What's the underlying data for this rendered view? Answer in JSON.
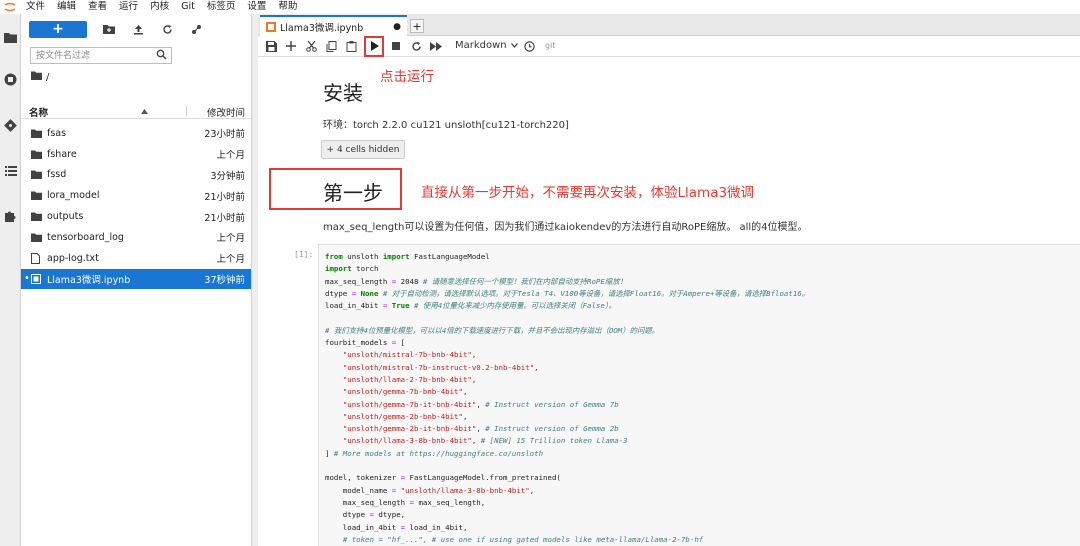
{
  "menu": [
    "文件",
    "编辑",
    "查看",
    "运行",
    "内核",
    "Git",
    "标签页",
    "设置",
    "帮助"
  ],
  "file_browser": {
    "new_label": "+",
    "filter_placeholder": "按文件名过滤",
    "breadcrumb": "/",
    "col_name": "名称",
    "col_modified": "修改时间",
    "items": [
      {
        "name": "fsas",
        "modified": "23小时前",
        "kind": "folder"
      },
      {
        "name": "fshare",
        "modified": "上个月",
        "kind": "folder"
      },
      {
        "name": "fssd",
        "modified": "3分钟前",
        "kind": "folder"
      },
      {
        "name": "lora_model",
        "modified": "21小时前",
        "kind": "folder"
      },
      {
        "name": "outputs",
        "modified": "21小时前",
        "kind": "folder"
      },
      {
        "name": "tensorboard_log",
        "modified": "上个月",
        "kind": "folder"
      },
      {
        "name": "app-log.txt",
        "modified": "上个月",
        "kind": "file"
      },
      {
        "name": "Llama3微调.ipynb",
        "modified": "37秒钟前",
        "kind": "notebook"
      }
    ]
  },
  "tab": {
    "title": "Llama3微调.ipynb",
    "add": "+"
  },
  "toolbar": {
    "cell_type": "Markdown",
    "git": "git"
  },
  "annotations": {
    "run": "点击运行",
    "step": "直接从第一步开始，不需要再次安装，体验Llama3微调"
  },
  "notebook": {
    "h_install": "安装",
    "env_line": "环境：torch 2.2.0 cu121 unsloth[cu121-torch220]",
    "hidden_cells": "+ 4 cells hidden",
    "h_step": "第一步",
    "maxseq_line": "max_seq_length可以设置为任何值，因为我们通过kaiokendev的方法进行自动RoPE缩放。 all的4位模型。",
    "prompt": "[1]:"
  },
  "code_lines": [
    [
      [
        "kw",
        "from"
      ],
      [
        "t",
        " unsloth "
      ],
      [
        "kw",
        "import"
      ],
      [
        "t",
        " FastLanguageModel"
      ]
    ],
    [
      [
        "kw",
        "import"
      ],
      [
        "t",
        " torch"
      ]
    ],
    [
      [
        "t",
        "max_seq_length "
      ],
      [
        "op",
        "="
      ],
      [
        "t",
        " 2048 "
      ],
      [
        "cm",
        "# 请随意选择任何一个模型！我们在内部自动支持RoPE缩放！"
      ]
    ],
    [
      [
        "t",
        "dtype "
      ],
      [
        "op",
        "="
      ],
      [
        "t",
        " "
      ],
      [
        "kw",
        "None"
      ],
      [
        "t",
        " "
      ],
      [
        "cm",
        "# 对于自动检测，请选择默认选项。对于Tesla T4、V100等设备，请选择Float16。对于Ampere+等设备，请选择Bfloat16。"
      ]
    ],
    [
      [
        "t",
        "load_in_4bit "
      ],
      [
        "op",
        "="
      ],
      [
        "t",
        " "
      ],
      [
        "kw",
        "True"
      ],
      [
        "t",
        " "
      ],
      [
        "cm",
        "# 使用4位量化来减少内存使用量。可以选择关闭（False）。"
      ]
    ],
    [
      [
        "t",
        ""
      ]
    ],
    [
      [
        "cm",
        "# 我们支持4位预量化模型，可以以4倍的下载速度进行下载，并且不会出现内存溢出（OOM）的问题。"
      ]
    ],
    [
      [
        "t",
        "fourbit_models "
      ],
      [
        "op",
        "="
      ],
      [
        "t",
        " ["
      ]
    ],
    [
      [
        "t",
        "    "
      ],
      [
        "st",
        "\"unsloth/mistral-7b-bnb-4bit\""
      ],
      [
        "t",
        ","
      ]
    ],
    [
      [
        "t",
        "    "
      ],
      [
        "st",
        "\"unsloth/mistral-7b-instruct-v0.2-bnb-4bit\""
      ],
      [
        "t",
        ","
      ]
    ],
    [
      [
        "t",
        "    "
      ],
      [
        "st",
        "\"unsloth/llama-2-7b-bnb-4bit\""
      ],
      [
        "t",
        ","
      ]
    ],
    [
      [
        "t",
        "    "
      ],
      [
        "st",
        "\"unsloth/gemma-7b-bnb-4bit\""
      ],
      [
        "t",
        ","
      ]
    ],
    [
      [
        "t",
        "    "
      ],
      [
        "st",
        "\"unsloth/gemma-7b-it-bnb-4bit\""
      ],
      [
        "t",
        ", "
      ],
      [
        "cm",
        "# Instruct version of Gemma 7b"
      ]
    ],
    [
      [
        "t",
        "    "
      ],
      [
        "st",
        "\"unsloth/gemma-2b-bnb-4bit\""
      ],
      [
        "t",
        ","
      ]
    ],
    [
      [
        "t",
        "    "
      ],
      [
        "st",
        "\"unsloth/gemma-2b-it-bnb-4bit\""
      ],
      [
        "t",
        ", "
      ],
      [
        "cm",
        "# Instruct version of Gemma 2b"
      ]
    ],
    [
      [
        "t",
        "    "
      ],
      [
        "st",
        "\"unsloth/llama-3-8b-bnb-4bit\""
      ],
      [
        "t",
        ", "
      ],
      [
        "cm",
        "# [NEW] 15 Trillion token Llama-3"
      ]
    ],
    [
      [
        "t",
        "] "
      ],
      [
        "cm",
        "# More models at https://huggingface.co/unsloth"
      ]
    ],
    [
      [
        "t",
        ""
      ]
    ],
    [
      [
        "t",
        "model, tokenizer "
      ],
      [
        "op",
        "="
      ],
      [
        "t",
        " FastLanguageModel.from_pretrained("
      ]
    ],
    [
      [
        "t",
        "    model_name "
      ],
      [
        "op",
        "="
      ],
      [
        "t",
        " "
      ],
      [
        "st",
        "\"unsloth/llama-3-8b-bnb-4bit\""
      ],
      [
        "t",
        ","
      ]
    ],
    [
      [
        "t",
        "    max_seq_length "
      ],
      [
        "op",
        "="
      ],
      [
        "t",
        " max_seq_length,"
      ]
    ],
    [
      [
        "t",
        "    dtype "
      ],
      [
        "op",
        "="
      ],
      [
        "t",
        " dtype,"
      ]
    ],
    [
      [
        "t",
        "    load_in_4bit "
      ],
      [
        "op",
        "="
      ],
      [
        "t",
        " load_in_4bit,"
      ]
    ],
    [
      [
        "t",
        "    "
      ],
      [
        "cm",
        "# token = \"hf_...\", # use one if using gated models like meta-llama/Llama-2-7b-hf"
      ]
    ]
  ]
}
